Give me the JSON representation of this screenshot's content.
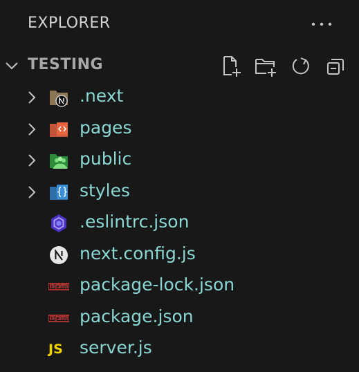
{
  "header": {
    "title": "EXPLORER",
    "more_icon": "ellipsis-icon"
  },
  "section": {
    "title": "TESTING",
    "actions": [
      {
        "name": "new-file-button",
        "icon": "new-file-icon"
      },
      {
        "name": "new-folder-button",
        "icon": "new-folder-icon"
      },
      {
        "name": "refresh-button",
        "icon": "refresh-icon"
      },
      {
        "name": "collapse-all-button",
        "icon": "collapse-all-icon"
      }
    ]
  },
  "tree": {
    "items": [
      {
        "label": ".next",
        "type": "folder",
        "icon": "nextjs-folder-icon"
      },
      {
        "label": "pages",
        "type": "folder",
        "icon": "pages-folder-icon"
      },
      {
        "label": "public",
        "type": "folder",
        "icon": "public-folder-icon"
      },
      {
        "label": "styles",
        "type": "folder",
        "icon": "styles-folder-icon"
      },
      {
        "label": ".eslintrc.json",
        "type": "file",
        "icon": "eslint-icon"
      },
      {
        "label": "next.config.js",
        "type": "file",
        "icon": "nextjs-icon"
      },
      {
        "label": "package-lock.json",
        "type": "file",
        "icon": "npm-icon"
      },
      {
        "label": "package.json",
        "type": "file",
        "icon": "npm-icon"
      },
      {
        "label": "server.js",
        "type": "file",
        "icon": "javascript-icon",
        "icon_text": "JS"
      }
    ]
  },
  "colors": {
    "background": "#181818",
    "label": "#89d6d3",
    "header_text": "#d4d4d4",
    "section_text": "#a8a8a8",
    "icon_gray": "#c5c5c5"
  }
}
